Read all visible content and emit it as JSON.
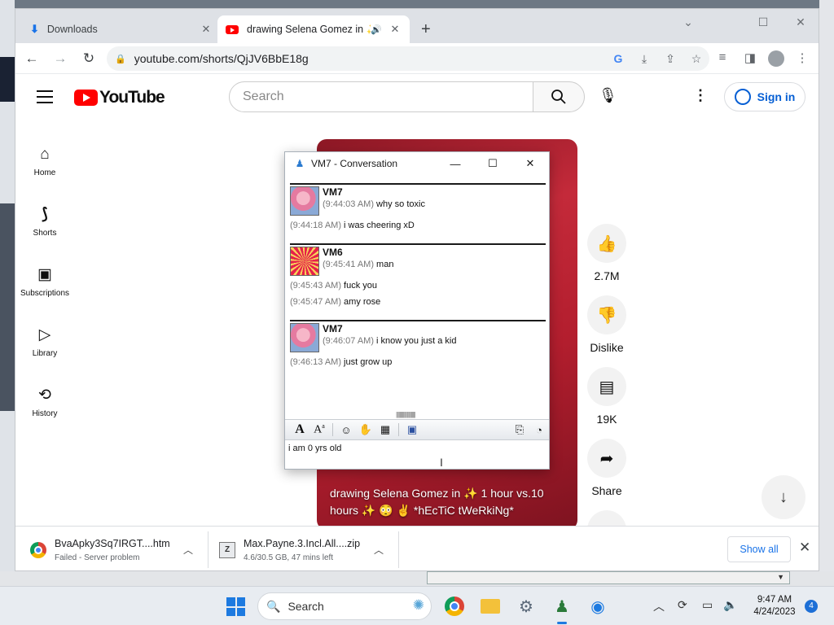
{
  "browser": {
    "tabs": [
      {
        "title": "Downloads"
      },
      {
        "title": "drawing Selena Gomez in ✨"
      }
    ],
    "url": "youtube.com/shorts/QjJV6BbE18g"
  },
  "youtube": {
    "logo_text": "YouTube",
    "search_placeholder": "Search",
    "signin_label": "Sign in",
    "sidebar": [
      {
        "label": "Home",
        "icon": "home-icon"
      },
      {
        "label": "Shorts",
        "icon": "shorts-icon"
      },
      {
        "label": "Subscriptions",
        "icon": "subscriptions-icon"
      },
      {
        "label": "Library",
        "icon": "library-icon"
      },
      {
        "label": "History",
        "icon": "history-icon"
      }
    ],
    "video_title": "drawing Selena Gomez in ✨ 1 hour vs.10 hours ✨ 😳 ✌ *hEcTiC tWeRkiNg*",
    "actions": {
      "like_count": "2.7M",
      "dislike_label": "Dislike",
      "comments_count": "19K",
      "share_label": "Share"
    }
  },
  "conversation": {
    "title": "VM7 - Conversation",
    "blocks": [
      {
        "sender": "VM7",
        "avatar": "amy-rose-avatar",
        "lines": [
          {
            "time": "(9:44:03 AM)",
            "text": "why so toxic"
          },
          {
            "time": "(9:44:18 AM)",
            "text": "i was cheering xD"
          }
        ]
      },
      {
        "sender": "VM6",
        "avatar": "burst-avatar",
        "lines": [
          {
            "time": "(9:45:41 AM)",
            "text": "man"
          },
          {
            "time": "(9:45:43 AM)",
            "text": "fuck you"
          },
          {
            "time": "(9:45:47 AM)",
            "text": "amy rose"
          }
        ]
      },
      {
        "sender": "VM7",
        "avatar": "amy-rose-avatar",
        "lines": [
          {
            "time": "(9:46:07 AM)",
            "text": "i know you just a kid"
          },
          {
            "time": "(9:46:13 AM)",
            "text": "just grow up"
          }
        ]
      }
    ],
    "input_text": "i am 0 yrs old"
  },
  "downloads": [
    {
      "name": "BvaApky3Sq7IRGT....htm",
      "status": "Failed - Server problem"
    },
    {
      "name": "Max.Payne.3.Incl.All....zip",
      "status": "4.6/30.5 GB, 47 mins left"
    }
  ],
  "shelf": {
    "show_all": "Show all"
  },
  "taskbar": {
    "search_label": "Search",
    "time": "9:47 AM",
    "date": "4/24/2023",
    "notifications": "4"
  },
  "colors": {
    "youtube_red": "#ff0000",
    "link_blue": "#065fd4",
    "chrome_blue": "#1a73e8"
  }
}
